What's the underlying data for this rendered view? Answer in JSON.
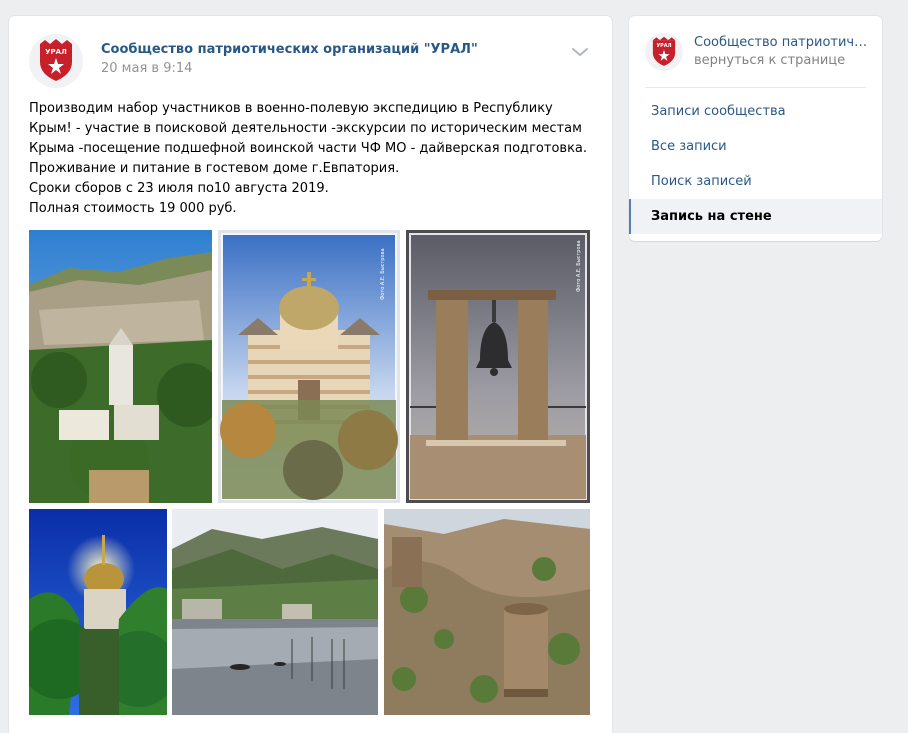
{
  "post": {
    "author": "Сообщество патриотических организаций \"УРАЛ\"",
    "date": "20 мая в 9:14",
    "text_lines": [
      "Производим набор участников в военно-полевую экспедицию в Республику",
      "Крым! - участие в поисковой деятельности -экскурсии по историческим местам",
      "Крыма -посещение подшефной воинской части ЧФ МО - дайверская подготовка.",
      "Проживание и питание в гостевом доме г.Евпатория.",
      "Сроки сборов с 23 июля по10 августа 2019.",
      "Полная стоимость 19 000 руб."
    ],
    "photo_captions": {
      "cathedral": "Фото А.Е. Быстрова",
      "bell": "Фото А.Е. Быстрова"
    }
  },
  "logo": {
    "text": "УРАЛ",
    "colors": {
      "shield": "#c8202a",
      "text": "#ffffff",
      "star": "#ffffff"
    }
  },
  "sidebar": {
    "community_name": "Сообщество патриотические организации \"УРАЛ\"",
    "back_link": "вернуться к странице",
    "items": [
      {
        "label": "Записи сообщества",
        "active": false
      },
      {
        "label": "Все записи",
        "active": false
      },
      {
        "label": "Поиск записей",
        "active": false
      },
      {
        "label": "Запись на стене",
        "active": true
      }
    ]
  },
  "colors": {
    "link": "#2a5885",
    "background": "#edeef0",
    "date": "#939393",
    "active_border": "#5181b8"
  },
  "icons": {
    "post_menu": "chevron-down-icon"
  }
}
